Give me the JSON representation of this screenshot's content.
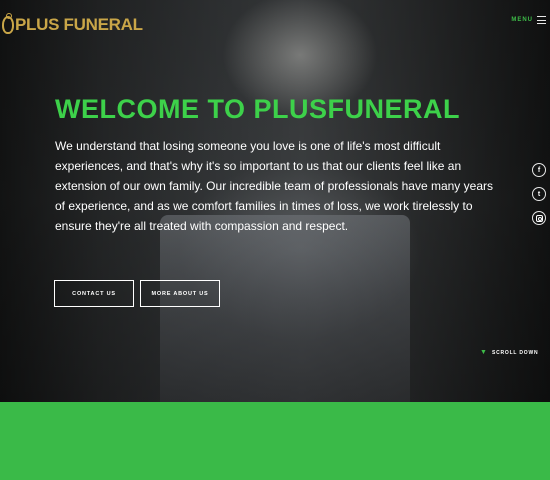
{
  "brand": {
    "logo_text": "PLUS FUNERAL",
    "gold": "#c9a648"
  },
  "header": {
    "menu_label": "MENU",
    "menu_icon": "hamburger-icon"
  },
  "hero": {
    "title": "WELCOME TO PLUSFUNERAL",
    "intro": "We understand that losing someone you love is one of life's most difficult experiences, and that's why it's so important to us that our clients feel like an extension of our own family. Our incredible team of professionals have many years of experience, and as we comfort families in times of loss, we work tirelessly to ensure they're all treated with compassion and respect.",
    "buttons": {
      "contact": "CONTACT US",
      "about": "MORE ABOUT US"
    },
    "scroll_label": "SCROLL DOWN",
    "scroll_icon": "chevron-down-icon"
  },
  "social": {
    "facebook": "f",
    "twitter": "t",
    "icons": [
      "facebook-icon",
      "twitter-icon",
      "instagram-icon"
    ]
  },
  "colors": {
    "accent_green": "#3dd14a",
    "band_green": "#3aba48",
    "text": "#ffffff"
  }
}
